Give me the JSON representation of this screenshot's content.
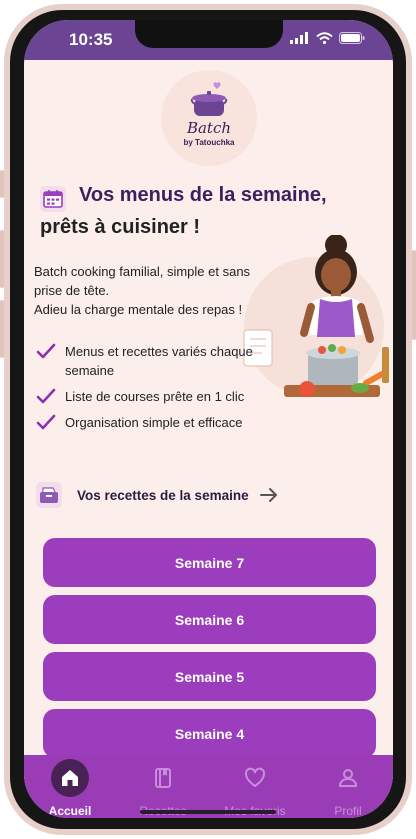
{
  "status_bar": {
    "time": "10:35"
  },
  "logo": {
    "title": "Batch",
    "subtitle": "by Tatouchka"
  },
  "header": {
    "line1": "Vos menus de la semaine,",
    "line2": "prêts à cuisiner !"
  },
  "intro": {
    "text1": "Batch cooking familial, simple et sans prise de tête.",
    "text2": "Adieu la charge mentale des repas !"
  },
  "features": [
    "Menus et recettes variés chaque semaine",
    "Liste de courses prête en 1 clic",
    "Organisation simple et efficace"
  ],
  "recettes_link": {
    "label": "Vos recettes de la semaine"
  },
  "weeks": [
    "Semaine 7",
    "Semaine 6",
    "Semaine 5",
    "Semaine 4"
  ],
  "nav": {
    "items": [
      {
        "label": "Accueil",
        "icon": "home-icon",
        "active": true
      },
      {
        "label": "Recettes",
        "icon": "book-icon"
      },
      {
        "label": "Mes favoris",
        "icon": "heart-icon"
      },
      {
        "label": "Profil",
        "icon": "user-icon"
      }
    ]
  },
  "colors": {
    "status_bar": "#6b4593",
    "background": "#fcefeb",
    "primary_button": "#9b3dbd",
    "nav_bar": "#9a3cb5",
    "title": "#3b1f5e",
    "check": "#8e2fb0"
  }
}
